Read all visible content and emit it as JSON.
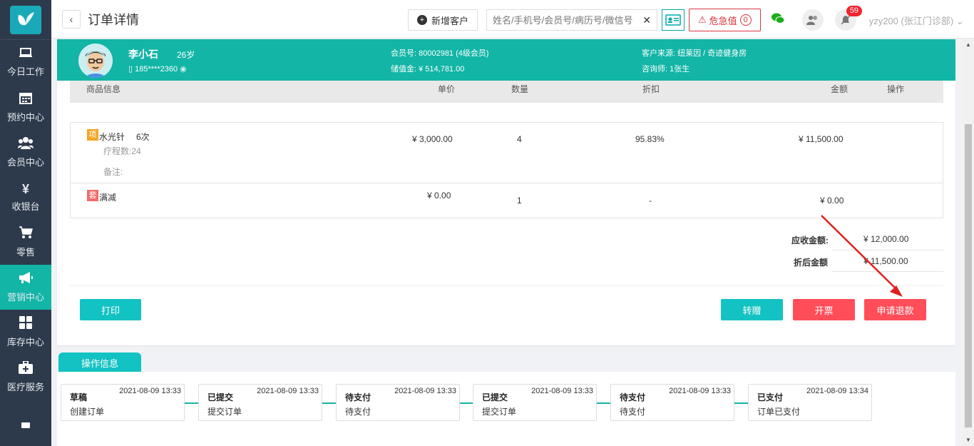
{
  "sidebar": {
    "items": [
      {
        "label": "今日工作",
        "icon": "laptop-icon"
      },
      {
        "label": "预约中心",
        "icon": "calendar-icon"
      },
      {
        "label": "会员中心",
        "icon": "users-icon"
      },
      {
        "label": "收银台",
        "icon": "yen-icon"
      },
      {
        "label": "零售",
        "icon": "cart-icon"
      },
      {
        "label": "营销中心",
        "icon": "megaphone-icon"
      },
      {
        "label": "库存中心",
        "icon": "grid-icon"
      },
      {
        "label": "医疗服务",
        "icon": "medkit-icon"
      }
    ],
    "active_index": 5
  },
  "header": {
    "title": "订单详情",
    "new_customer_label": "新增客户",
    "search_placeholder": "姓名/手机号/会员号/病历号/微信号",
    "danger_label": "危急值",
    "danger_count": "0",
    "notification_count": "59",
    "user_label": "yzy200 (张江门诊部)"
  },
  "customer": {
    "name": "李小石",
    "age": "26岁",
    "phone": "185****2360",
    "member_no": "会员号: 80002981 (4级会员)",
    "balance": "储值金:  ¥ 514,781.00",
    "source": "客户来源: 纽莱因 / 奇迹健身房",
    "consultant": "咨询师:  1张生"
  },
  "table": {
    "headers": {
      "product": "商品信息",
      "price": "单价",
      "qty": "数量",
      "discount": "折扣",
      "amount": "金额",
      "action": "操作"
    },
    "rows": [
      {
        "tag": "项",
        "name": "水光针",
        "times": "6次",
        "course": "疗程数:24",
        "note": "备注:",
        "price": "¥ 3,000.00",
        "qty": "4",
        "discount": "95.83%",
        "amount": "¥ 11,500.00"
      },
      {
        "tag": "套",
        "name": "满减",
        "price": "¥ 0.00",
        "qty": "1",
        "discount": "-",
        "amount": "¥ 0.00"
      }
    ]
  },
  "summary": {
    "receivable_label": "应收金额:",
    "receivable_value": "¥ 12,000.00",
    "discounted_label": "折后金额",
    "discounted_value": "¥ 11,500.00"
  },
  "actions": {
    "print": "打印",
    "transfer": "转赠",
    "invoice": "开票",
    "refund": "申请退款"
  },
  "operation": {
    "tab_label": "操作信息",
    "steps": [
      {
        "status": "草稿",
        "time": "2021-08-09 13:33",
        "desc": "创建订单"
      },
      {
        "status": "已提交",
        "time": "2021-08-09 13:33",
        "desc": "提交订单"
      },
      {
        "status": "待支付",
        "time": "2021-08-09 13:33",
        "desc": "待支付"
      },
      {
        "status": "已提交",
        "time": "2021-08-09 13:33",
        "desc": "提交订单"
      },
      {
        "status": "待支付",
        "time": "2021-08-09 13:33",
        "desc": "待支付"
      },
      {
        "status": "已支付",
        "time": "2021-08-09 13:34",
        "desc": "订单已支付"
      }
    ]
  },
  "colors": {
    "accent": "#12b5a6",
    "sidebar": "#2d3a4b",
    "danger": "#ff4d5a",
    "annotation": "#e02020"
  }
}
